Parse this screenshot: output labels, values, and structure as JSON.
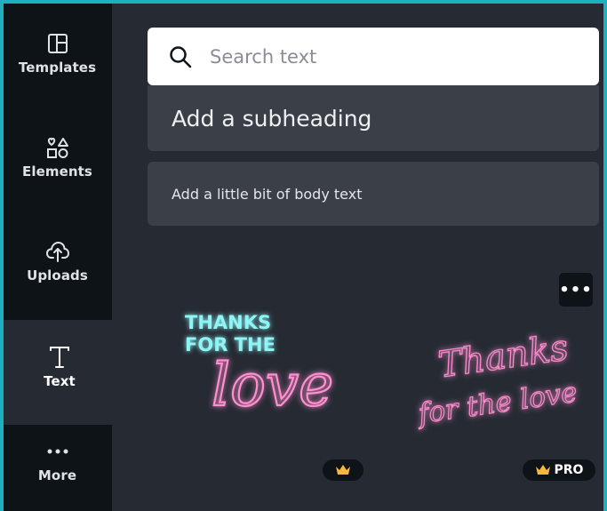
{
  "sidebar": {
    "items": [
      {
        "label": "Templates",
        "icon": "templates-icon"
      },
      {
        "label": "Elements",
        "icon": "elements-icon"
      },
      {
        "label": "Uploads",
        "icon": "upload-cloud-icon"
      },
      {
        "label": "Text",
        "icon": "text-icon",
        "active": true
      },
      {
        "label": "More",
        "icon": "more-icon"
      }
    ]
  },
  "panel": {
    "search": {
      "placeholder": "Search text",
      "value": ""
    },
    "subheading_label": "Add a subheading",
    "body_label": "Add a little bit of body text",
    "more_label": "•••",
    "tiles": [
      {
        "lines": [
          "THANKS",
          "FOR THE",
          "love"
        ],
        "badge_icon": "crown-icon"
      },
      {
        "lines": [
          "Thanks",
          "for the love"
        ],
        "badge_icon": "crown-icon",
        "badge_text": "PRO"
      }
    ]
  },
  "colors": {
    "frame": "#1fb0bf",
    "sidebar": "#0e1318",
    "panel": "#252a33",
    "button": "#3a3f48",
    "neon_cyan": "#8ff4f4",
    "neon_pink": "#ff8fd0",
    "crown": "#f5b83d"
  }
}
